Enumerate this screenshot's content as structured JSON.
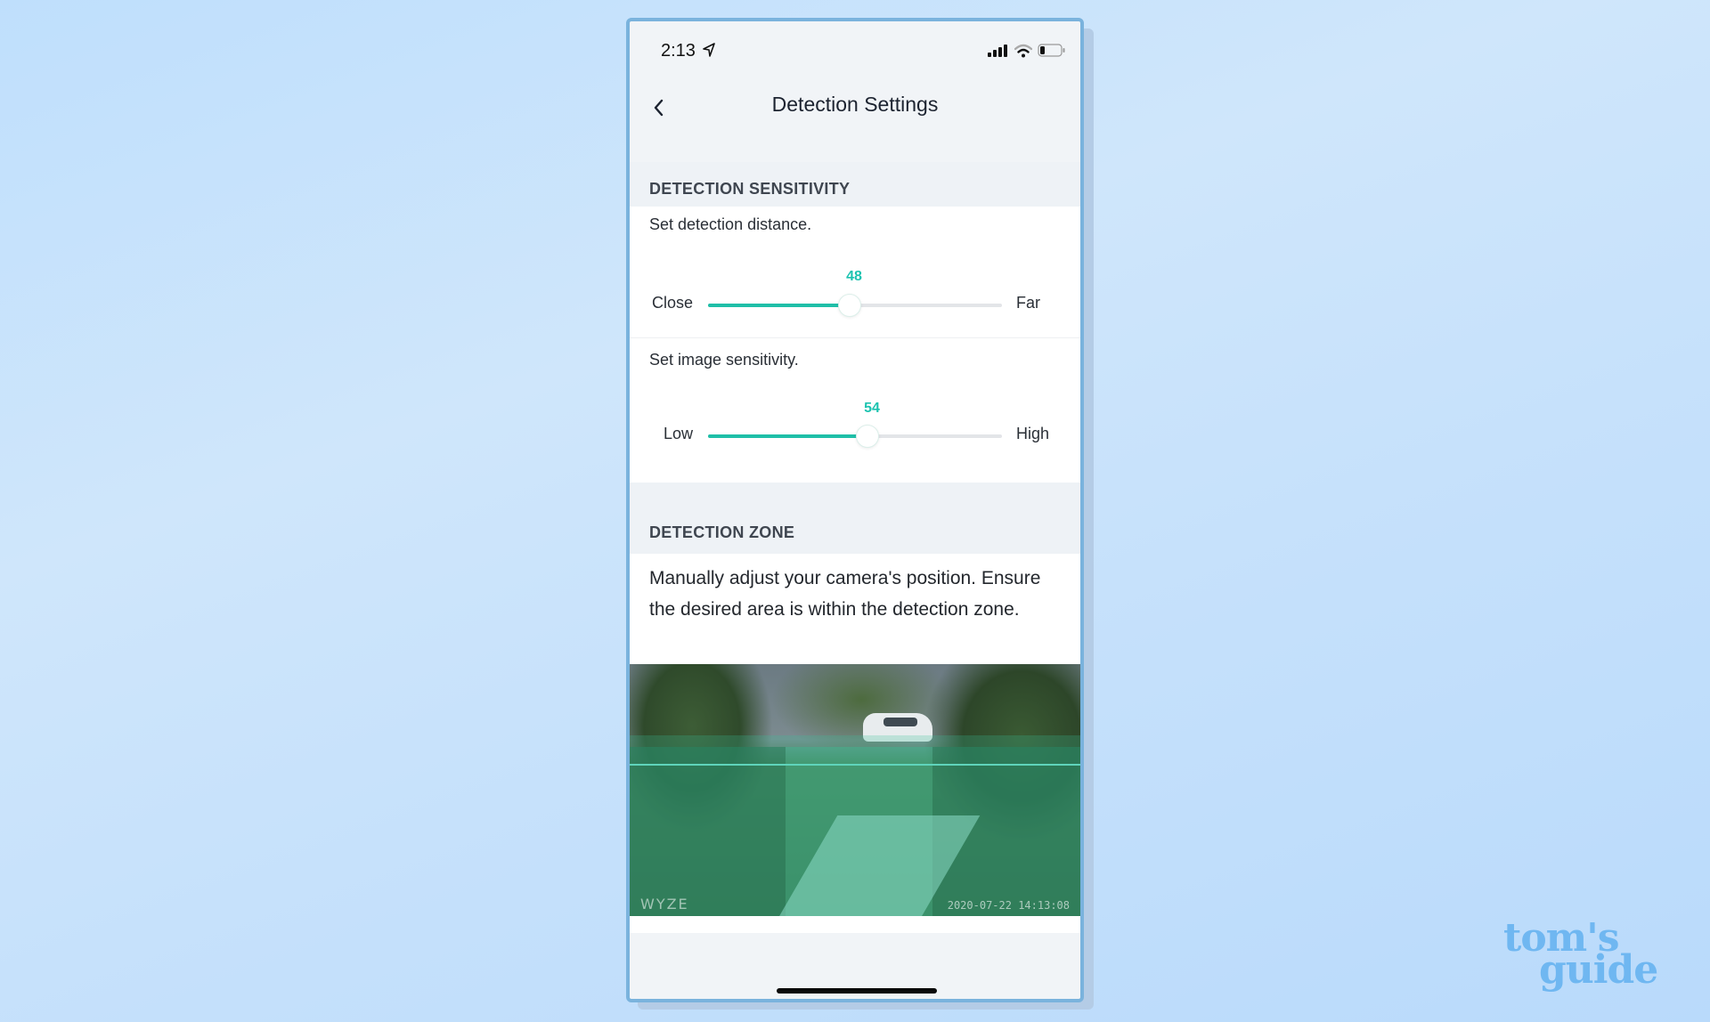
{
  "status_bar": {
    "time": "2:13",
    "location_icon": "location-arrow-icon",
    "signal_icon": "cellular-signal-icon",
    "wifi_icon": "wifi-icon",
    "battery_icon": "battery-low-icon",
    "battery_level": 0.2
  },
  "nav": {
    "back_icon": "chevron-left-icon",
    "title": "Detection Settings"
  },
  "detection_sensitivity": {
    "header": "DETECTION SENSITIVITY",
    "distance": {
      "label": "Set detection distance.",
      "value": 48,
      "value_text": "48",
      "min_label": "Close",
      "max_label": "Far",
      "min": 0,
      "max": 100
    },
    "image": {
      "label": "Set image sensitivity.",
      "value": 54,
      "value_text": "54",
      "min_label": "Low",
      "max_label": "High",
      "min": 0,
      "max": 100
    }
  },
  "detection_zone": {
    "header": "DETECTION ZONE",
    "description": "Manually adjust your camera's position. Ensure the desired area is within the detection zone.",
    "camera": {
      "brand_watermark": "WYZE",
      "timestamp": "2020-07-22 14:13:08"
    }
  },
  "colors": {
    "accent": "#1fbfa8",
    "zone_overlay": "#38be96"
  },
  "watermark": {
    "line1": "tom's",
    "line2": "guide"
  }
}
